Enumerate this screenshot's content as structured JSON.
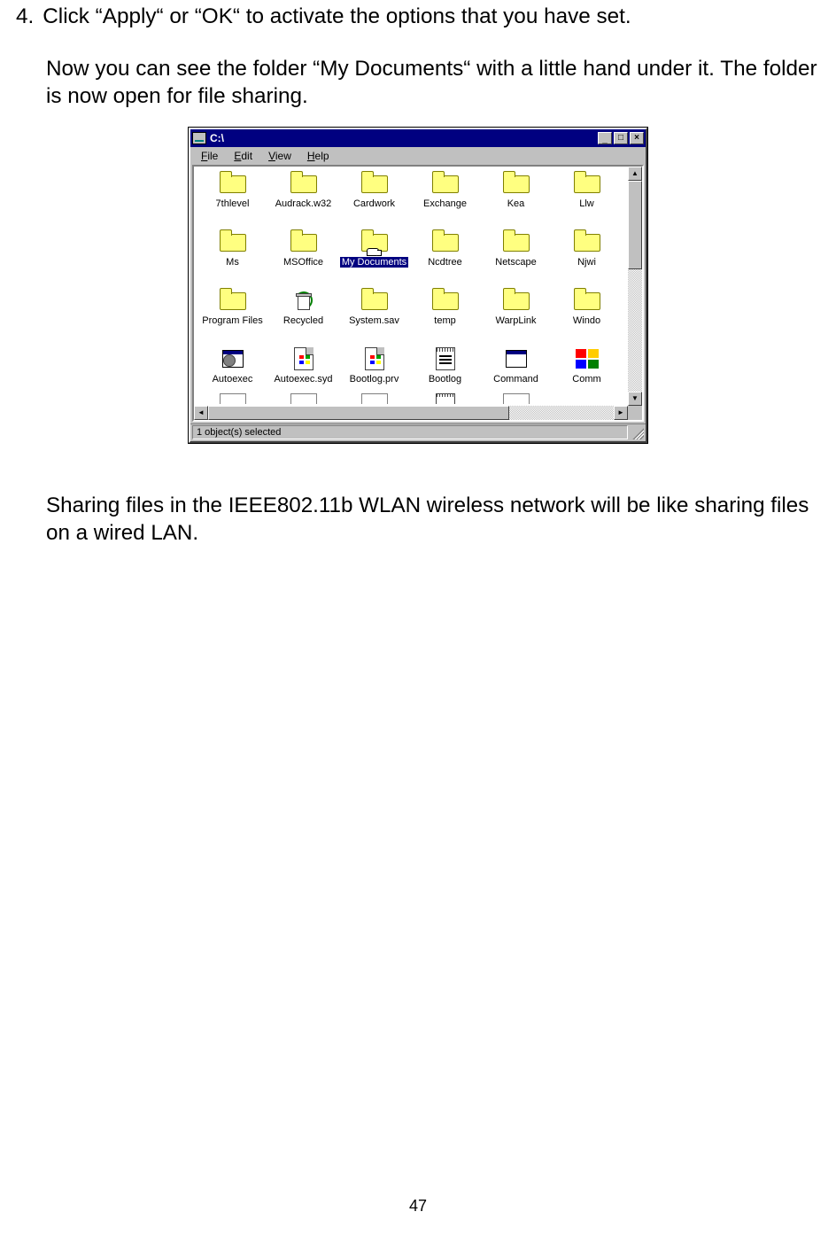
{
  "doc": {
    "step_number": "4.",
    "step_text": "Click “Apply“ or  “OK“ to activate the options that you have set.",
    "para1": "Now you can see the folder “My Documents“ with a little hand under it. The folder is now open for file sharing.",
    "para2": "Sharing files in the IEEE802.11b WLAN wireless network will be like sharing files on a wired LAN.",
    "page_number": "47"
  },
  "window": {
    "title": "C:\\",
    "menu": {
      "file": "File",
      "edit": "Edit",
      "view": "View",
      "help": "Help"
    },
    "status": "1 object(s) selected",
    "items": [
      {
        "label": "7thlevel",
        "type": "folder"
      },
      {
        "label": "Audrack.w32",
        "type": "folder"
      },
      {
        "label": "Cardwork",
        "type": "folder"
      },
      {
        "label": "Exchange",
        "type": "folder"
      },
      {
        "label": "Kea",
        "type": "folder"
      },
      {
        "label": "Llw",
        "type": "folder"
      },
      {
        "label": "Ms",
        "type": "folder"
      },
      {
        "label": "MSOffice",
        "type": "folder"
      },
      {
        "label": "My Documents",
        "type": "folder",
        "selected": true,
        "shared": true
      },
      {
        "label": "Ncdtree",
        "type": "folder"
      },
      {
        "label": "Netscape",
        "type": "folder"
      },
      {
        "label": "Njwi",
        "type": "folder"
      },
      {
        "label": "Program Files",
        "type": "folder"
      },
      {
        "label": "Recycled",
        "type": "recycle"
      },
      {
        "label": "System.sav",
        "type": "folder"
      },
      {
        "label": "temp",
        "type": "folder"
      },
      {
        "label": "WarpLink",
        "type": "folder"
      },
      {
        "label": "Windo",
        "type": "folder"
      },
      {
        "label": "Autoexec",
        "type": "autoexec"
      },
      {
        "label": "Autoexec.syd",
        "type": "winfile"
      },
      {
        "label": "Bootlog.prv",
        "type": "winfile"
      },
      {
        "label": "Bootlog",
        "type": "notepad"
      },
      {
        "label": "Command",
        "type": "dosbox"
      },
      {
        "label": "Comm",
        "type": "colorful"
      }
    ]
  }
}
